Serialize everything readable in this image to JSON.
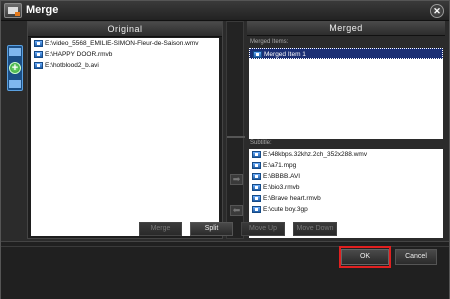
{
  "window": {
    "title": "Merge",
    "close_glyph": "✕"
  },
  "original": {
    "header": "Original",
    "items": [
      "E:\\video_5568_EMILIE-SIMON-Fleur-de-Saison.wmv",
      "E:\\HAPPY DOOR.rmvb",
      "E:\\hotblood2_b.avi"
    ]
  },
  "merged": {
    "header": "Merged",
    "merged_items_label": "Merged Items:",
    "merged_items": [
      "Merged Item 1"
    ],
    "subtitle_label": "Subtitle:",
    "subtitle_items": [
      "E:\\48kbps.32khz.2ch_352x288.wmv",
      "E:\\a71.mpg",
      "E:\\BBBB.AVI",
      "E:\\bio3.rmvb",
      "E:\\Brave heart.rmvb",
      "E:\\cute boy.3gp"
    ]
  },
  "buttons": {
    "merge": "Merge",
    "split": "Split",
    "move_up": "Move Up",
    "move_down": "Move Down",
    "ok": "OK",
    "cancel": "Cancel"
  },
  "icons": {
    "arrow_right": "➡",
    "arrow_left": "⬅",
    "add": "+"
  },
  "colors": {
    "selected_row": "#1b2f74",
    "highlight_ok": "#e02020"
  }
}
